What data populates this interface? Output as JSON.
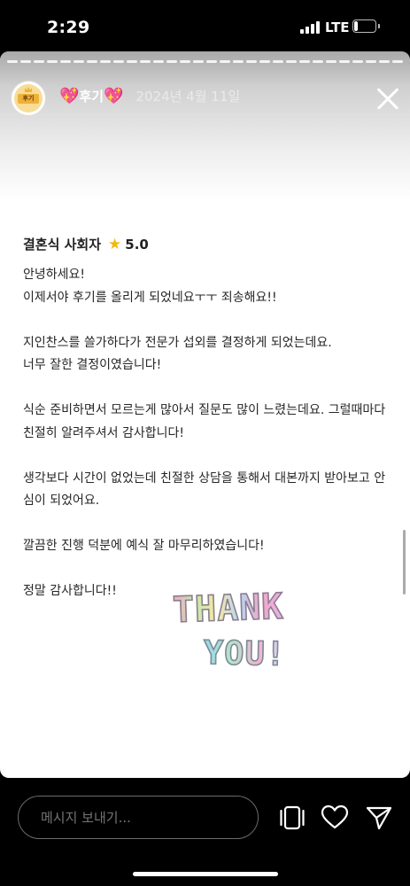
{
  "status_bar": {
    "time": "2:29",
    "network": "LTE",
    "battery_level": "5",
    "battery_fraction": 0.15
  },
  "story": {
    "progress_segments": 30,
    "title": "후기",
    "title_emoji": "💖",
    "date": "2024년 4월 11일",
    "avatar_label": "후기"
  },
  "review": {
    "service": "결혼식 사회자",
    "rating": "5.0",
    "body": "안녕하세요!\n이제서야 후기를 올리게 되었네요ㅜㅜ 죄송해요!!\n\n지인찬스를 쓸가하다가 전문가 섭외를 결정하게 되었는데요.\n너무 잘한 결정이였습니다!\n\n식순 준비하면서 모르는게 많아서 질문도 많이 느렸는데요. 그럴때마다 친절히 알려주셔서 감사합니다!\n\n생각보다 시간이 없었는데 친절한 상담을 통해서 대본까지 받아보고 안심이 되었어요.\n\n깔끔한 진행 덕분에 예식 잘 마무리하였습니다!\n\n정말 감사합니다!!"
  },
  "sticker": {
    "line1": "THANK",
    "line2": "YOU!"
  },
  "bottom": {
    "message_placeholder": "메시지 보내기...",
    "icons": [
      "carousel-icon",
      "heart-icon",
      "send-icon"
    ]
  },
  "colors": {
    "background": "#000000",
    "rating_star": "#f2b90c",
    "text": "#222222"
  }
}
